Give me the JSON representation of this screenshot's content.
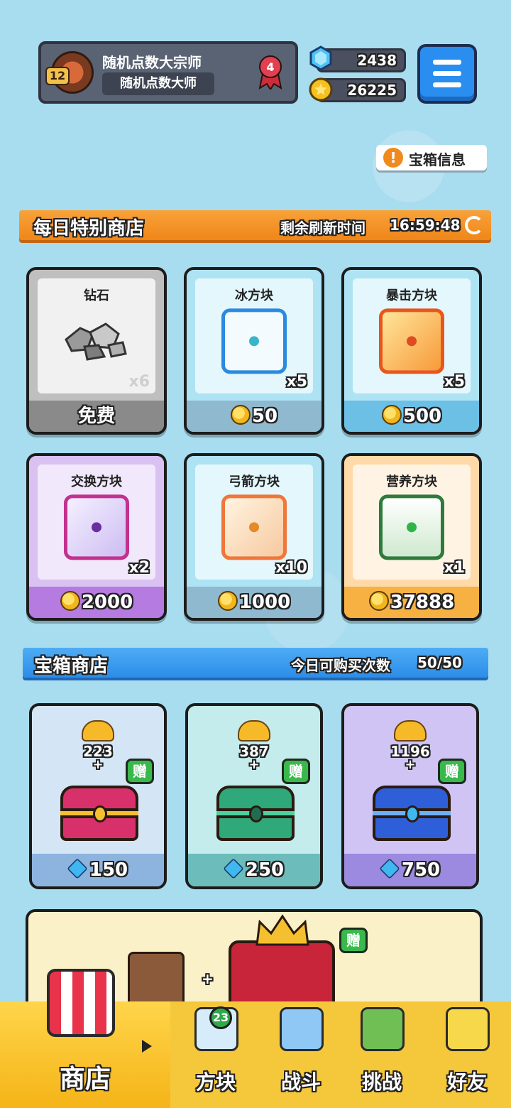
{
  "profile": {
    "level": "12",
    "name": "随机点数大宗师",
    "title": "随机点数大师",
    "rank_badge": "4"
  },
  "currency": {
    "gems": "2438",
    "gold": "26225"
  },
  "chest_info_label": "宝箱信息",
  "daily_shop": {
    "title": "每日特别商店",
    "refresh_label": "剩余刷新时间",
    "refresh_time": "16:59:48",
    "items": [
      {
        "name": "钻石",
        "qty": "x6",
        "price": "免费",
        "icon": "diamond-ore-icon",
        "currency": "none"
      },
      {
        "name": "冰方块",
        "qty": "x5",
        "price": "50",
        "icon": "ice-block-icon",
        "currency": "gold"
      },
      {
        "name": "暴击方块",
        "qty": "x5",
        "price": "500",
        "icon": "crit-block-icon",
        "currency": "gold"
      },
      {
        "name": "交换方块",
        "qty": "x2",
        "price": "2000",
        "icon": "swap-block-icon",
        "currency": "gold"
      },
      {
        "name": "弓箭方块",
        "qty": "x10",
        "price": "1000",
        "icon": "bow-block-icon",
        "currency": "gold"
      },
      {
        "name": "营养方块",
        "qty": "x1",
        "price": "37888",
        "icon": "nutrition-block-icon",
        "currency": "gold"
      }
    ]
  },
  "chest_shop": {
    "title": "宝箱商店",
    "limit_label": "今日可购买次数",
    "limit_value": "50/50",
    "gift_label": "赠",
    "plus": "+",
    "chests": [
      {
        "gold": "223",
        "price": "150",
        "icon": "red-chest-icon"
      },
      {
        "gold": "387",
        "price": "250",
        "icon": "green-chest-icon"
      },
      {
        "gold": "1196",
        "price": "750",
        "icon": "blue-chest-icon"
      }
    ]
  },
  "promo": {
    "gift_label": "赠",
    "plus": "+"
  },
  "nav": {
    "items": [
      {
        "label": "商店",
        "icon": "shop-icon"
      },
      {
        "label": "方块",
        "icon": "block-icon",
        "badge": "23"
      },
      {
        "label": "战斗",
        "icon": "battle-icon"
      },
      {
        "label": "挑战",
        "icon": "challenge-icon"
      },
      {
        "label": "好友",
        "icon": "friends-icon"
      }
    ]
  },
  "colors": {
    "background": "#a8dcef",
    "orange_banner": "#f08619",
    "blue_banner": "#2c8de8",
    "menu_button": "#2a8ef0",
    "nav_bar": "#f5c83c"
  }
}
